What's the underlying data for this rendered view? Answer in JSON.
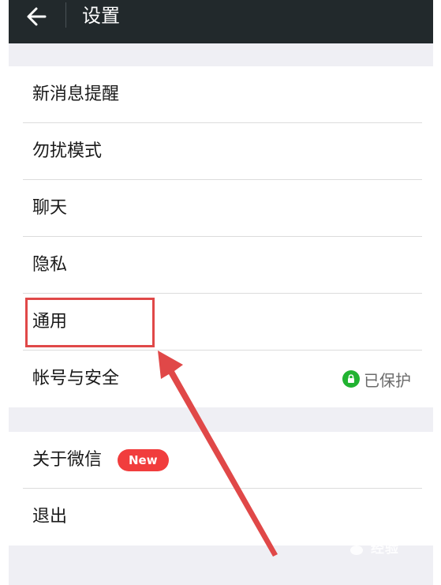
{
  "titlebar": {
    "title": "设置",
    "background": "#22292c"
  },
  "settings_group_1": [
    {
      "label": "新消息提醒"
    },
    {
      "label": "勿扰模式"
    },
    {
      "label": "聊天"
    },
    {
      "label": "隐私"
    },
    {
      "label": "通用"
    },
    {
      "label": "帐号与安全",
      "status": "已保护",
      "status_icon": "lock-icon"
    }
  ],
  "settings_group_2": [
    {
      "label": "关于微信",
      "badge": "New"
    },
    {
      "label": "退出"
    }
  ],
  "colors": {
    "accent_green": "#21b331",
    "badge_red": "#f13d3d",
    "annotation_red": "#e04848",
    "page_background": "#efeff4"
  },
  "annotation": {
    "highlighted_item": "通用"
  },
  "watermark": {
    "text": "Bai経验"
  }
}
